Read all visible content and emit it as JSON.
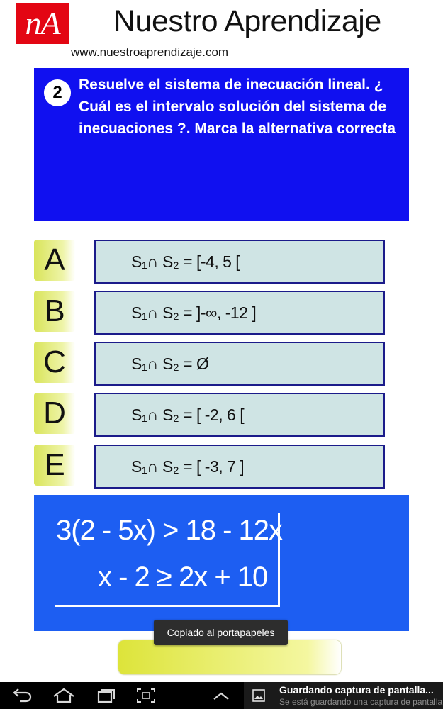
{
  "header": {
    "logo_text": "nA",
    "title": "Nuestro Aprendizaje",
    "url": "www.nuestroaprendizaje.com"
  },
  "question": {
    "number": "2",
    "text": "Resuelve el sistema de inecuación lineal. ¿ Cuál es el intervalo solución del sistema de inecuaciones ?. Marca la alternativa correcta"
  },
  "options": [
    {
      "letter": "A",
      "text": "S₁∩ S₂ = [-4, 5 ["
    },
    {
      "letter": "B",
      "text": "S₁∩ S₂ = ]-∞, -12 ]"
    },
    {
      "letter": "C",
      "text": "S₁∩ S₂ =  Ø"
    },
    {
      "letter": "D",
      "text": "S₁∩ S₂ =  [ -2, 6 ["
    },
    {
      "letter": "E",
      "text": "S₁∩ S₂ =  [ -3, 7 ]"
    }
  ],
  "equations": {
    "line1": "3(2 - 5x) > 18 - 12x",
    "line2": "x - 2 ≥ 2x + 10"
  },
  "toast": {
    "text": "Copiado al portapapeles"
  },
  "navbar": {
    "notification_title": "Guardando captura de pantalla...",
    "notification_subtitle": "Se está guardando una captura de pantalla"
  },
  "colors": {
    "logo_bg": "#e30613",
    "question_bg": "#1010f0",
    "equation_bg": "#1d5ef2",
    "option_bg": "#cfe4e4",
    "option_letter_bg": "#d9e45a"
  }
}
